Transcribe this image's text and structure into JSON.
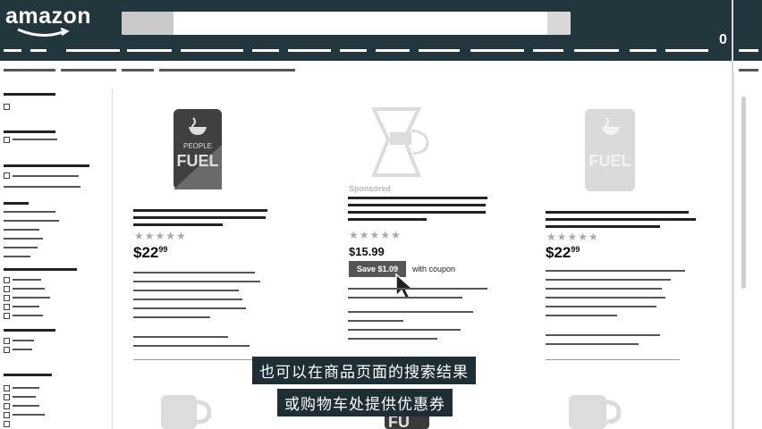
{
  "header": {
    "logo_text": "amazon",
    "cart_count": "0"
  },
  "products": [
    {
      "image_label": "PEOPLE",
      "image_label2": "FUEL",
      "price_main": "$22",
      "price_cents": "99",
      "stars": "★★★★★"
    },
    {
      "sponsored_label": "Sponsored",
      "price_main": "$15.99",
      "stars": "★★★★★",
      "coupon_badge": "Save $1.09",
      "coupon_suffix": "with coupon"
    },
    {
      "image_label2": "FUEL",
      "price_main": "$22",
      "price_cents": "99",
      "stars": "★★★★★"
    }
  ],
  "bottom_partial_label": "FU",
  "subtitles": {
    "line1": "也可以在商品页面的搜索结果",
    "line2": "或购物车处提供优惠券"
  },
  "colors": {
    "header_bg": "#22363d",
    "subtitle_bg": "#1d2e35",
    "badge_bg": "#565656"
  }
}
